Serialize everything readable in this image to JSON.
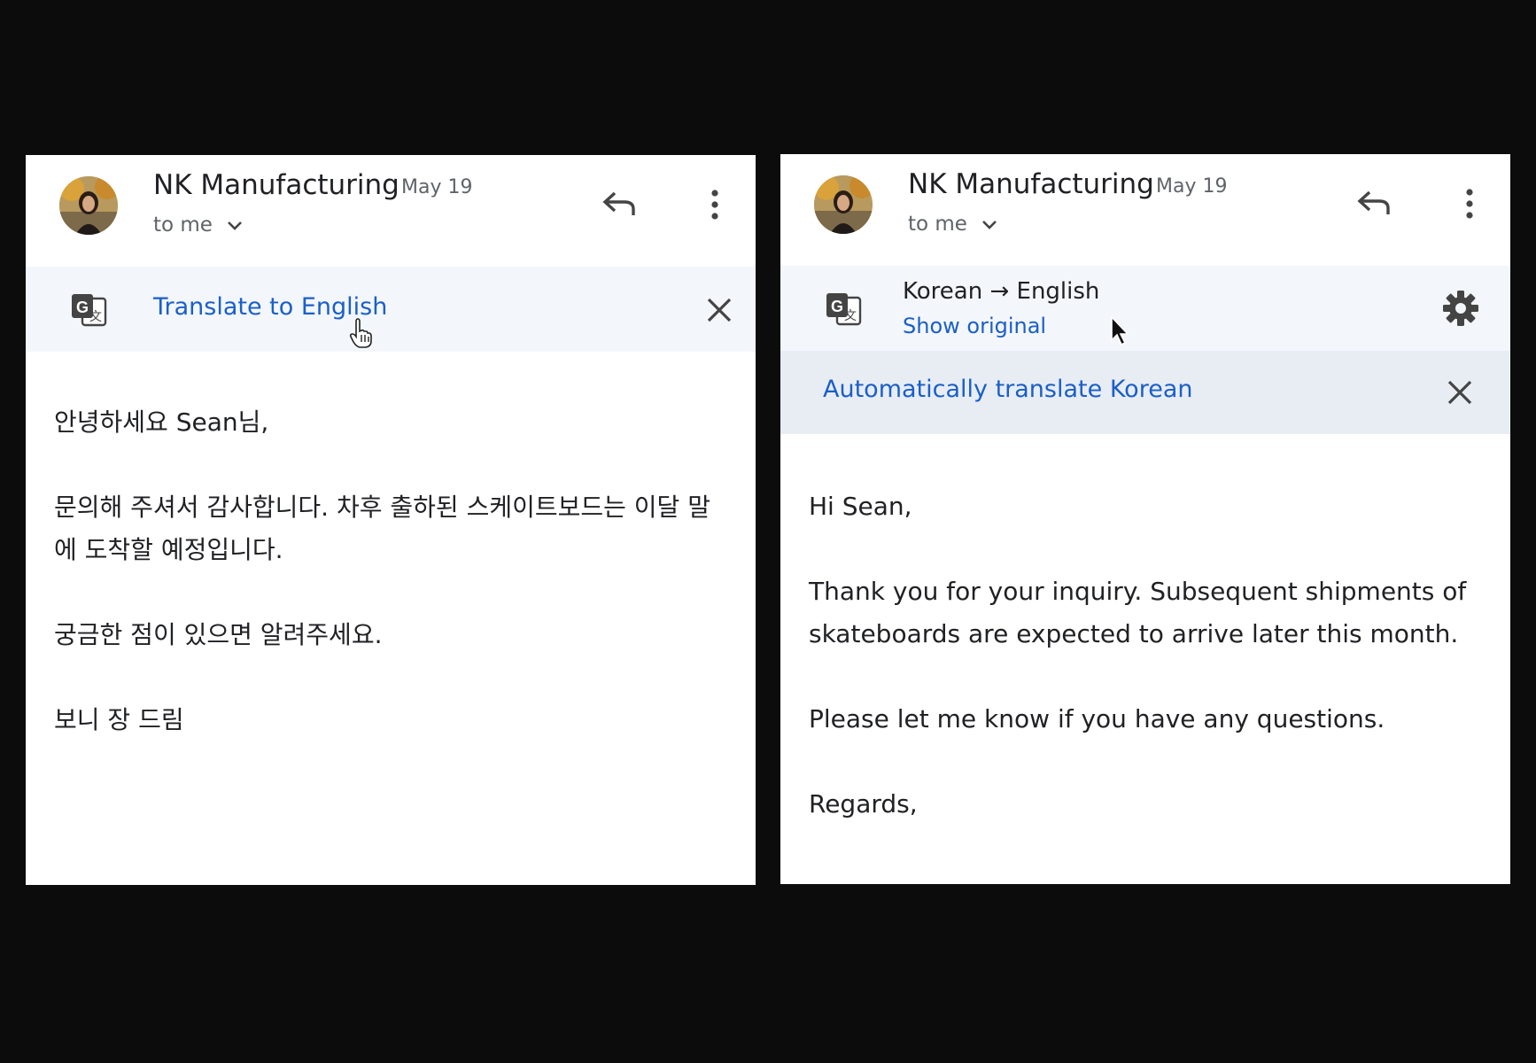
{
  "left_email": {
    "sender": "NK Manufacturing",
    "date": "May 19",
    "recipient_label": "to me",
    "translate_bar": {
      "link_label": "Translate to English"
    },
    "body": {
      "greeting": "안녕하세요 Sean님,",
      "paragraph1": "문의해 주셔서 감사합니다. 차후 출하된 스케이트보드는 이달 말에 도착할 예정입니다.",
      "paragraph2": "궁금한 점이 있으면 알려주세요.",
      "signoff": "보니 장 드림"
    }
  },
  "right_email": {
    "sender": "NK Manufacturing",
    "date": "May 19",
    "recipient_label": "to me",
    "translate_bar": {
      "language_from": "Korean",
      "arrow": "→",
      "language_to": "English",
      "show_original_label": "Show original"
    },
    "auto_translate_bar": {
      "link_label": "Automatically translate Korean"
    },
    "body": {
      "greeting": "Hi Sean,",
      "paragraph1": "Thank you for your inquiry. Subsequent shipments of skateboards are expected to arrive later this month.",
      "paragraph2": "Please let me know if you have any questions.",
      "signoff": "Regards,"
    }
  },
  "colors": {
    "background": "#0c0c0d",
    "link_blue": "#1a5fc8",
    "translate_bar_bg": "#f3f6fb",
    "auto_bar_bg": "#e8edf4"
  },
  "icons": [
    "reply-icon",
    "more-vert-icon",
    "chevron-down-icon",
    "google-translate-icon",
    "close-icon",
    "gear-icon"
  ]
}
